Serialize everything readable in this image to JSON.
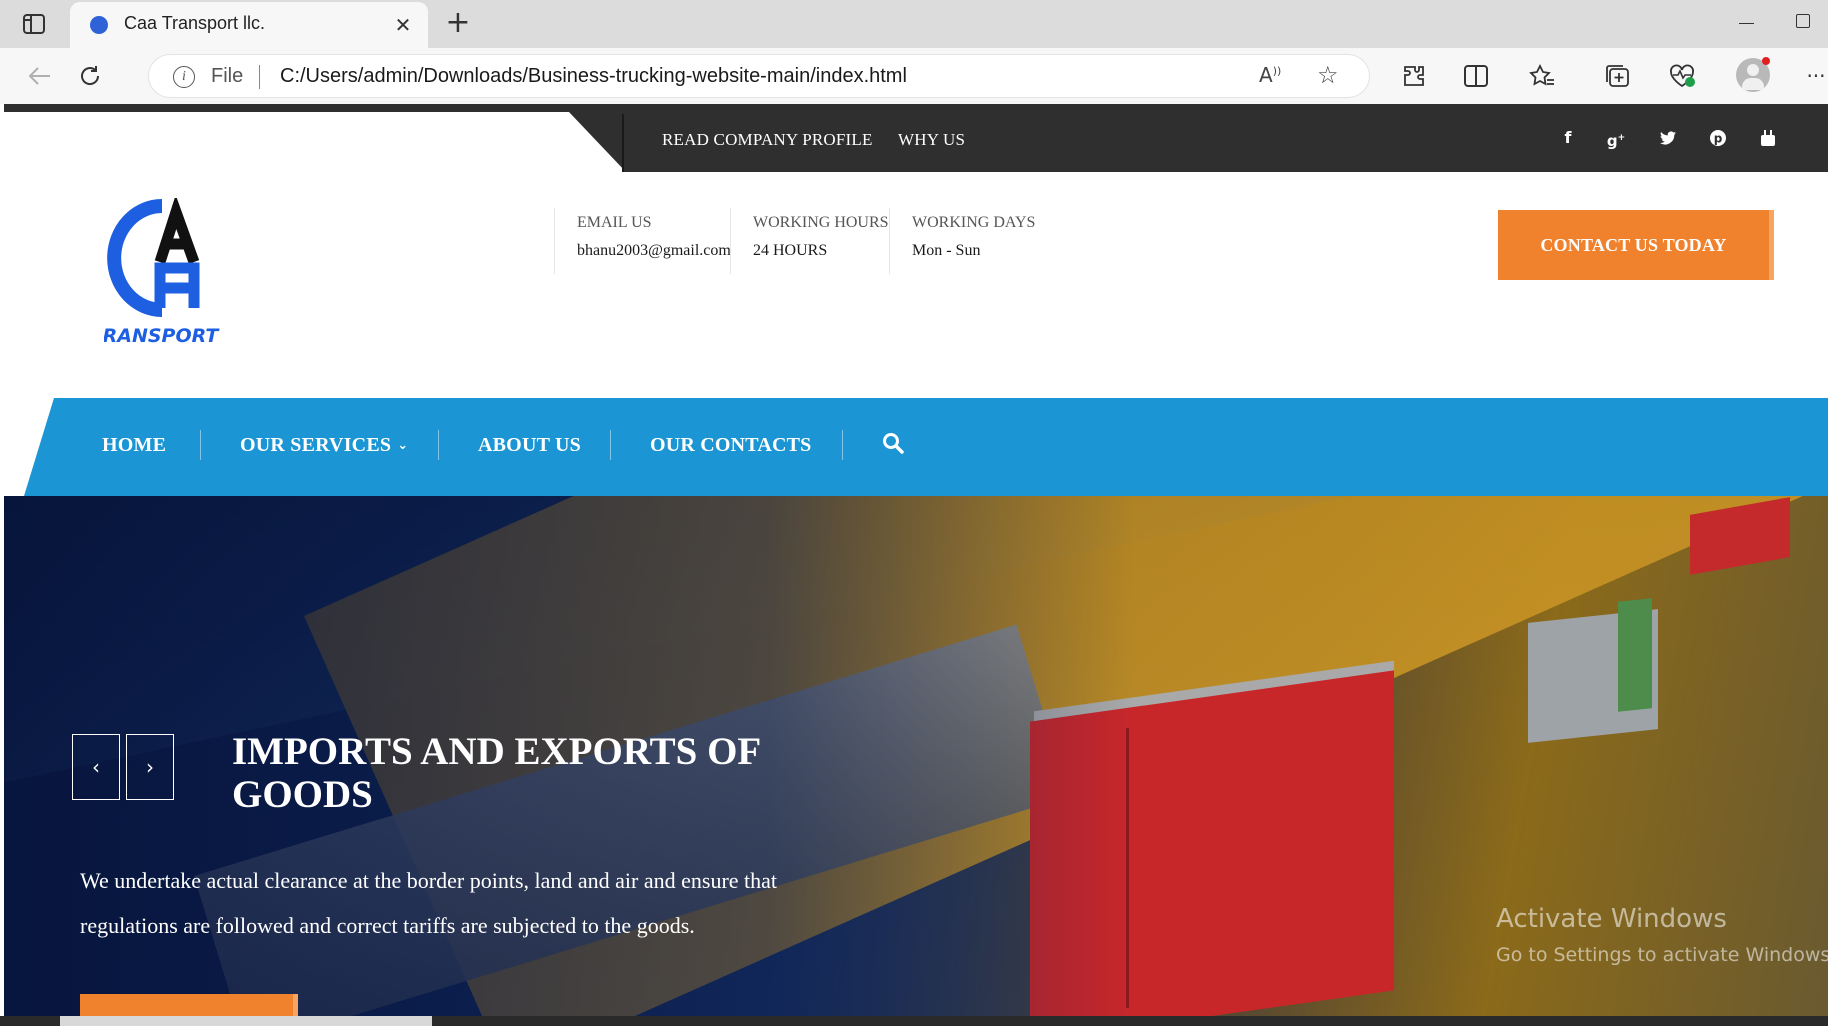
{
  "browser": {
    "tab_title": "Caa Transport llc.",
    "address_scheme": "File",
    "address_url": "C:/Users/admin/Downloads/Business-trucking-website-main/index.html"
  },
  "topbar": {
    "links": [
      "READ COMPANY PROFILE",
      "WHY US"
    ],
    "social_icons": [
      "facebook-icon",
      "google-plus-icon",
      "twitter-icon",
      "pinterest-icon",
      "youtube-icon"
    ]
  },
  "header": {
    "logo_text": "TRANSPORT",
    "info": [
      {
        "label": "EMAIL US",
        "value": "bhanu2003@gmail.com"
      },
      {
        "label": "WORKING HOURS",
        "value": "24 HOURS"
      },
      {
        "label": "WORKING DAYS",
        "value": "Mon - Sun"
      }
    ],
    "cta_label": "CONTACT US TODAY"
  },
  "nav": {
    "items": [
      "HOME",
      "OUR SERVICES",
      "ABOUT US",
      "OUR CONTACTS"
    ],
    "accent_color": "#1b95d3"
  },
  "hero": {
    "title": "IMPORTS AND EXPORTS OF GOODS",
    "text": "We undertake actual clearance at the border points, land and air and ensure that regulations are followed and correct tariffs are subjected to the goods.",
    "prev_icon": "chevron-left-icon",
    "next_icon": "chevron-right-icon"
  },
  "watermark": {
    "line1": "Activate Windows",
    "line2": "Go to Settings to activate Windows."
  },
  "colors": {
    "orange": "#f0822d",
    "dark_bar": "#2f2f2f",
    "logo_blue": "#1d5fe0"
  }
}
